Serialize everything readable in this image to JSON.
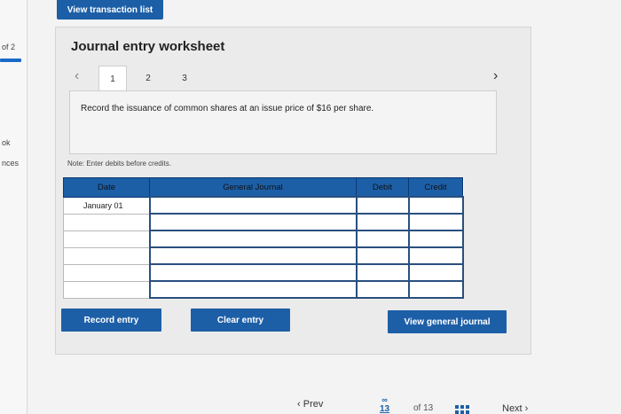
{
  "sidebar": {
    "page_fraction": "of 2",
    "item1": "ok",
    "item2": "nces"
  },
  "toolbar": {
    "view_transactions": "View transaction list"
  },
  "worksheet": {
    "title": "Journal entry worksheet",
    "tabs": [
      "1",
      "2",
      "3"
    ],
    "active_tab": "1",
    "prompt": "Record the issuance of common shares at an issue price of $16 per share.",
    "note": "Note: Enter debits before credits."
  },
  "table": {
    "headers": {
      "date": "Date",
      "account": "General Journal",
      "debit": "Debit",
      "credit": "Credit"
    },
    "rows": [
      {
        "date": "January 01",
        "account": "",
        "debit": "",
        "credit": ""
      },
      {
        "date": "",
        "account": "",
        "debit": "",
        "credit": ""
      },
      {
        "date": "",
        "account": "",
        "debit": "",
        "credit": ""
      },
      {
        "date": "",
        "account": "",
        "debit": "",
        "credit": ""
      },
      {
        "date": "",
        "account": "",
        "debit": "",
        "credit": ""
      },
      {
        "date": "",
        "account": "",
        "debit": "",
        "credit": ""
      }
    ]
  },
  "actions": {
    "record": "Record entry",
    "clear": "Clear entry",
    "view_journal": "View general journal"
  },
  "pagination": {
    "prev": "Prev",
    "current": "13",
    "of": "of 13",
    "next": "Next"
  },
  "colors": {
    "accent": "#1d5fa7",
    "header_border": "#0c3a73"
  },
  "icons": [
    "chevron-left-icon",
    "chevron-right-icon",
    "link-icon",
    "grid-icon"
  ]
}
